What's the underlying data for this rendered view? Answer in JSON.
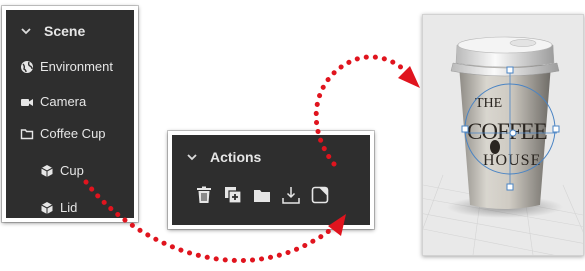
{
  "scene_panel": {
    "title": "Scene",
    "items": [
      {
        "label": "Environment",
        "icon": "globe-icon"
      },
      {
        "label": "Camera",
        "icon": "video-camera-icon"
      },
      {
        "label": "Coffee Cup",
        "icon": "folder-icon"
      },
      {
        "label": "Cup",
        "icon": "cube-icon"
      },
      {
        "label": "Lid",
        "icon": "cube-icon"
      }
    ]
  },
  "actions_panel": {
    "title": "Actions",
    "tools": [
      "trash-icon",
      "duplicate-icon",
      "group-folder-icon",
      "place-on-ground-icon",
      "apply-graphic-icon"
    ]
  },
  "viewport": {
    "cup_logo_top": "THE",
    "cup_logo_middle": "COFFEE",
    "cup_logo_bottom": "HOUSE"
  },
  "colors": {
    "panel_bg": "#2e2e2e",
    "panel_text": "#e6e6e6",
    "arrow_red": "#e0141e"
  }
}
